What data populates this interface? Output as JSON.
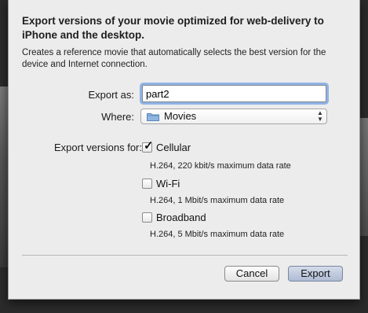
{
  "dialog": {
    "title": "Export versions of your movie optimized for web-delivery to iPhone and the desktop.",
    "description": "Creates a reference movie that automatically selects the best version for the device and Internet connection."
  },
  "form": {
    "export_as_label": "Export as:",
    "export_as_value": "part2",
    "where_label": "Where:",
    "where_value": "Movies",
    "versions_label": "Export versions for:"
  },
  "versions": [
    {
      "label": "Cellular",
      "checked": true,
      "detail": "H.264, 220 kbit/s maximum data rate"
    },
    {
      "label": "Wi-Fi",
      "checked": false,
      "detail": "H.264, 1 Mbit/s maximum data rate"
    },
    {
      "label": "Broadband",
      "checked": false,
      "detail": "H.264, 5 Mbit/s maximum data rate"
    }
  ],
  "buttons": {
    "cancel": "Cancel",
    "export": "Export"
  },
  "icons": {
    "folder": "folder-icon",
    "popup": "up-down-arrows-icon",
    "check": "checkmark-icon"
  },
  "colors": {
    "sheet_bg": "#ececec",
    "focus_ring": "#8fb3e6",
    "default_button": "#aebbd3"
  }
}
